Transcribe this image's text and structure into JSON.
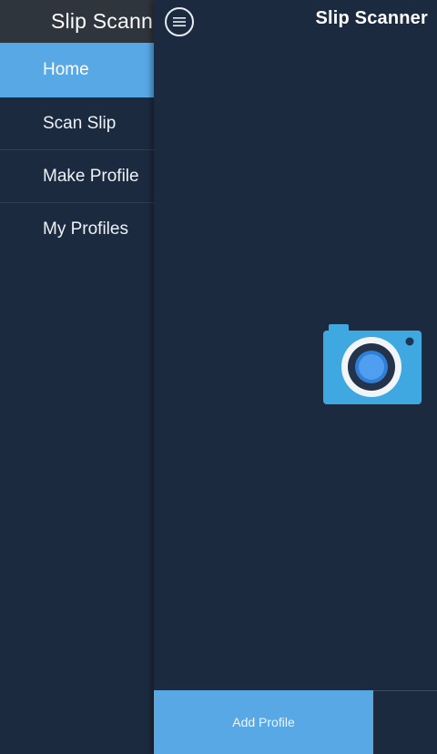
{
  "drawer": {
    "title": "Slip Scanner",
    "items": [
      {
        "label": "Home",
        "active": true
      },
      {
        "label": "Scan Slip",
        "active": false
      },
      {
        "label": "Make Profile",
        "active": false
      },
      {
        "label": "My Profiles",
        "active": false
      }
    ]
  },
  "header": {
    "title": "Slip Scanner",
    "menu_icon": "hamburger-circle-icon"
  },
  "main": {
    "camera_icon": "camera-icon"
  },
  "footer": {
    "add_profile_label": "Add Profile"
  },
  "colors": {
    "background": "#1c2a40",
    "accent": "#58a8e6",
    "drawer_header": "#2f353c",
    "camera_body": "#3fa8e0"
  }
}
